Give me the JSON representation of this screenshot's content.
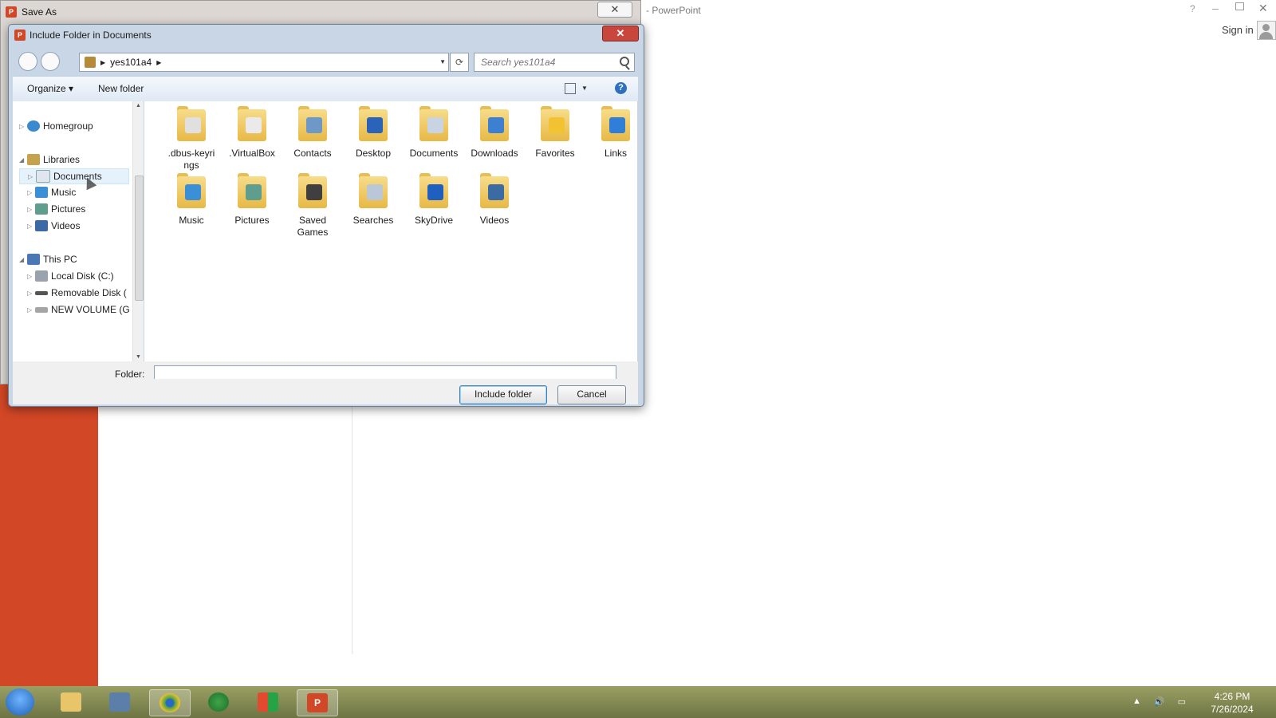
{
  "powerpoint": {
    "title": "- PowerPoint",
    "help": "?",
    "minimize": "–",
    "close": "✕",
    "sign_in": "Sign in"
  },
  "save_as": {
    "title": "Save As",
    "close": "✕",
    "app_badge": "P"
  },
  "dialog": {
    "title": "Include Folder in Documents",
    "close": "✕",
    "address": {
      "segment": "yes101a4"
    },
    "search_placeholder": "Search yes101a4",
    "toolbar": {
      "organize": "Organize ▾",
      "new_folder": "New folder",
      "help": "?"
    },
    "nav": {
      "homegroup": "Homegroup",
      "libraries": "Libraries",
      "documents": "Documents",
      "music": "Music",
      "pictures": "Pictures",
      "videos": "Videos",
      "this_pc": "This PC",
      "local_disk": "Local Disk (C:)",
      "removable": "Removable Disk (",
      "new_volume": "NEW VOLUME (G"
    },
    "folders": [
      {
        "line1": ".dbus-keyri",
        "line2": "ngs",
        "badge": "#e0e0e0"
      },
      {
        "line1": ".VirtualBox",
        "line2": "",
        "badge": "#eaeaea"
      },
      {
        "line1": "Contacts",
        "line2": "",
        "badge": "#6d98c8"
      },
      {
        "line1": "Desktop",
        "line2": "",
        "badge": "#2b63b8"
      },
      {
        "line1": "Documents",
        "line2": "",
        "badge": "#c9d4e2"
      },
      {
        "line1": "Downloads",
        "line2": "",
        "badge": "#3d7fd1"
      },
      {
        "line1": "Favorites",
        "line2": "",
        "badge": "#f1c232"
      },
      {
        "line1": "Links",
        "line2": "",
        "badge": "#2f7ed8"
      },
      {
        "line1": "Music",
        "line2": "",
        "badge": "#3b8fd6"
      },
      {
        "line1": "Pictures",
        "line2": "",
        "badge": "#5f9e8f"
      },
      {
        "line1": "Saved",
        "line2": "Games",
        "badge": "#3f3f3f"
      },
      {
        "line1": "Searches",
        "line2": "",
        "badge": "#b9c7d6"
      },
      {
        "line1": "SkyDrive",
        "line2": "",
        "badge": "#1f5fbf"
      },
      {
        "line1": "Videos",
        "line2": "",
        "badge": "#3c6aa3"
      }
    ],
    "folder_label": "Folder:",
    "folder_value": "",
    "include_button": "Include folder",
    "cancel_button": "Cancel"
  },
  "taskbar": {
    "time": "4:26 PM",
    "date": "7/26/2024",
    "tray_up": "▲",
    "app_badge": "P"
  },
  "colors": {
    "ppt_accent": "#d24726",
    "dialog_frame": "#c9d6e6",
    "taskbar": "#7e8450"
  }
}
